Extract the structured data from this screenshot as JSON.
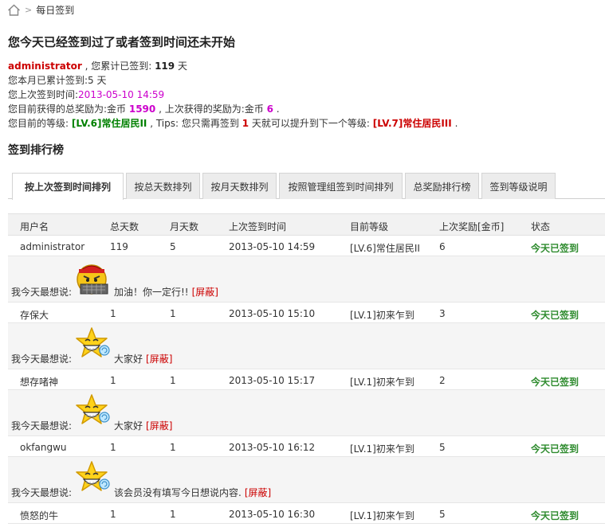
{
  "breadcrumb": {
    "home_icon": "home-icon",
    "separator": ">",
    "current": "每日签到"
  },
  "page_title": "您今天已经签到过了或者签到时间还未开始",
  "summary": {
    "username": "administrator",
    "total_prefix": " , 您累计已签到: ",
    "total_days": "119",
    "total_unit": " 天",
    "month_prefix": "您本月已累计签到:",
    "month_days": "5",
    "month_unit": " 天",
    "last_prefix": "您上次签到时间:",
    "last_time": "2013-05-10 14:59",
    "reward_prefix": "您目前获得的总奖励为:金币 ",
    "reward_total": "1590",
    "reward_mid": " , 上次获得的奖励为:金币 ",
    "reward_last": "6",
    "reward_end": " .",
    "level_prefix": "您目前的等级: ",
    "level_current": "[LV.6]常住居民II",
    "level_mid1": " , Tips: 您只需再签到 ",
    "level_need_days": "1",
    "level_mid2": " 天就可以提升到下一个等级: ",
    "level_next": "[LV.7]常住居民III",
    "level_end": " ."
  },
  "rank_title": "签到排行榜",
  "tabs": [
    {
      "label": "按上次签到时间排列",
      "active": true
    },
    {
      "label": "按总天数排列"
    },
    {
      "label": "按月天数排列"
    },
    {
      "label": "按照管理组签到时间排列"
    },
    {
      "label": "总奖励排行榜"
    },
    {
      "label": "签到等级说明"
    }
  ],
  "table": {
    "headers": [
      "用户名",
      "总天数",
      "月天数",
      "上次签到时间",
      "目前等级",
      "上次奖励[金币]",
      "状态"
    ],
    "rows": [
      {
        "user": "administrator",
        "total": "119",
        "month": "5",
        "time": "2013-05-10 14:59",
        "level": "[LV.6]常住居民II",
        "reward": "6",
        "status": "今天已签到"
      },
      {
        "user": "存保大",
        "total": "1",
        "month": "1",
        "time": "2013-05-10 15:10",
        "level": "[LV.1]初来乍到",
        "reward": "3",
        "status": "今天已签到"
      },
      {
        "user": "想存啫神",
        "total": "1",
        "month": "1",
        "time": "2013-05-10 15:17",
        "level": "[LV.1]初来乍到",
        "reward": "2",
        "status": "今天已签到"
      },
      {
        "user": "okfangwu",
        "total": "1",
        "month": "1",
        "time": "2013-05-10 16:12",
        "level": "[LV.1]初来乍到",
        "reward": "5",
        "status": "今天已签到"
      },
      {
        "user": "愤怒的牛",
        "total": "1",
        "month": "1",
        "time": "2013-05-10 16:30",
        "level": "[LV.1]初来乍到",
        "reward": "5",
        "status": "今天已签到"
      }
    ],
    "messages": [
      {
        "label": "我今天最想说:",
        "emoji": "angry-face-icon",
        "text": "加油！你一定行!!",
        "hide": "[屏蔽]"
      },
      {
        "label": "我今天最想说:",
        "emoji": "happy-star-face-icon",
        "text": "大家好",
        "hide": "[屏蔽]"
      },
      {
        "label": "我今天最想说:",
        "emoji": "happy-star-face-icon",
        "text": "大家好",
        "hide": "[屏蔽]"
      },
      {
        "label": "我今天最想说:",
        "emoji": "happy-star-face-icon",
        "text": "该会员没有填写今日想说内容.",
        "hide": "[屏蔽]"
      }
    ]
  },
  "colors": {
    "red": "#cc0000",
    "magenta": "#cc00cc",
    "green": "#008000",
    "status": "#2e8b2e"
  }
}
